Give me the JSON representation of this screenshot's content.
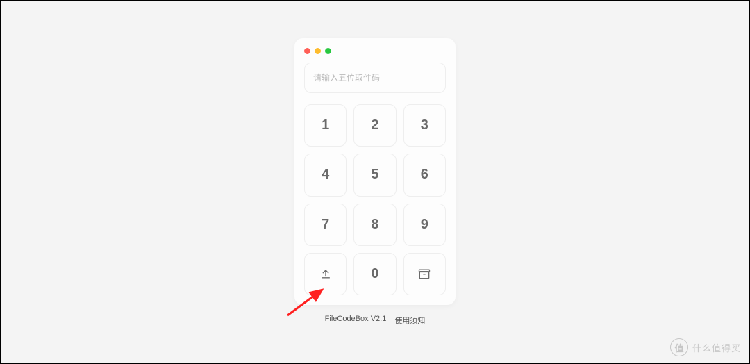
{
  "input": {
    "placeholder": "请输入五位取件码"
  },
  "keypad": {
    "keys": [
      "1",
      "2",
      "3",
      "4",
      "5",
      "6",
      "7",
      "8",
      "9",
      "upload",
      "0",
      "box"
    ]
  },
  "footer": {
    "appname": "FileCodeBox V2.1",
    "notice": "使用须知"
  },
  "watermark": {
    "badge": "值",
    "text": "什么值得买"
  }
}
